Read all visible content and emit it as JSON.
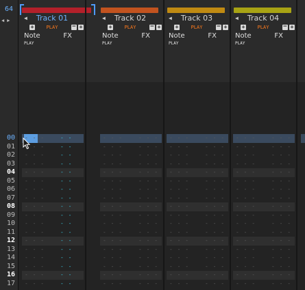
{
  "bpm": "64",
  "play_text": "PLAY",
  "note_text": "Note",
  "fx_text": "FX",
  "row_labels": [
    "00",
    "01",
    "02",
    "03",
    "04",
    "05",
    "06",
    "07",
    "08",
    "09",
    "10",
    "11",
    "12",
    "13",
    "14",
    "15",
    "16",
    "17"
  ],
  "current_row": "00",
  "tracks": [
    {
      "name": "Track 01",
      "color": "#b3202a",
      "selected": true
    },
    {
      "name": "Track 02",
      "color": "#c2531f",
      "selected": false
    },
    {
      "name": "Track 03",
      "color": "#c08a12",
      "selected": false
    },
    {
      "name": "Track 04",
      "color": "#a8a314",
      "selected": false
    }
  ],
  "empty_note": "- - -",
  "empty_fx": "- - -",
  "fx_marker": "- -",
  "colors": {
    "accent": "#4f9bff",
    "play": "#ff7a1c",
    "fx_marker": "#39c6e0",
    "current_row": "#3a4a5e"
  },
  "icons": [
    "mouse-pointer-icon"
  ]
}
